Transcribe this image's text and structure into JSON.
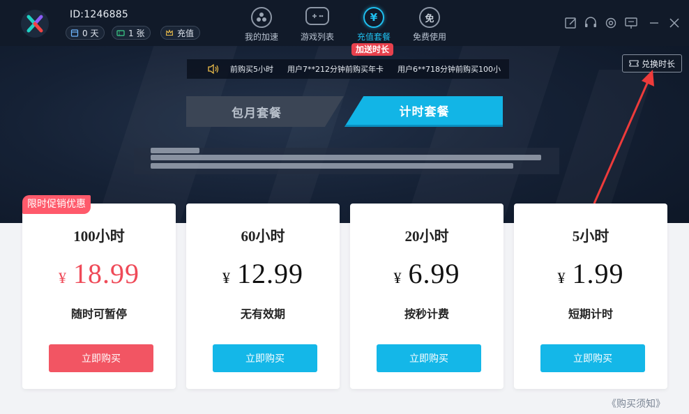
{
  "header": {
    "user_id": "ID:1246885",
    "chips": [
      {
        "icon": "calendar-icon",
        "label": "0 天"
      },
      {
        "icon": "ticket-icon",
        "label": "1 张"
      },
      {
        "icon": "crown-icon",
        "label": "充值"
      }
    ],
    "nav": [
      {
        "icon": "speed-fan-icon",
        "label": "我的加速"
      },
      {
        "icon": "gamepad-icon",
        "label": "游戏列表"
      },
      {
        "icon": "yen-icon",
        "label": "充值套餐",
        "active": true,
        "glyph": "¥"
      },
      {
        "icon": "free-icon",
        "label": "免费使用",
        "glyph": "免"
      }
    ],
    "nav_badge": "加送时长",
    "window_controls": [
      "feedback-icon",
      "headset-icon",
      "settings-icon",
      "screen-icon",
      "minimize-icon",
      "close-icon"
    ]
  },
  "notice": {
    "items": [
      "前购买5小时",
      "用户7**212分钟前购买年卡",
      "用户6**718分钟前购买100小"
    ]
  },
  "redeem": {
    "label": "兑换时长"
  },
  "tabs": [
    {
      "label": "包月套餐",
      "active": false
    },
    {
      "label": "计时套餐",
      "active": true
    }
  ],
  "promo_badge": "限时促销优惠",
  "plans": [
    {
      "hours": "100小时",
      "currency": "¥",
      "price": "18.99",
      "desc": "随时可暂停",
      "button": "立即购买",
      "highlight": true
    },
    {
      "hours": "60小时",
      "currency": "¥",
      "price": "12.99",
      "desc": "无有效期",
      "button": "立即购买",
      "highlight": false
    },
    {
      "hours": "20小时",
      "currency": "¥",
      "price": "6.99",
      "desc": "按秒计费",
      "button": "立即购买",
      "highlight": false
    },
    {
      "hours": "5小时",
      "currency": "¥",
      "price": "1.99",
      "desc": "短期计时",
      "button": "立即购买",
      "highlight": false
    }
  ],
  "footer": {
    "purchase_notice": "《购买须知》"
  },
  "colors": {
    "accent": "#12b5e6",
    "promo": "#f25563",
    "dark_bg": "#111a29"
  }
}
